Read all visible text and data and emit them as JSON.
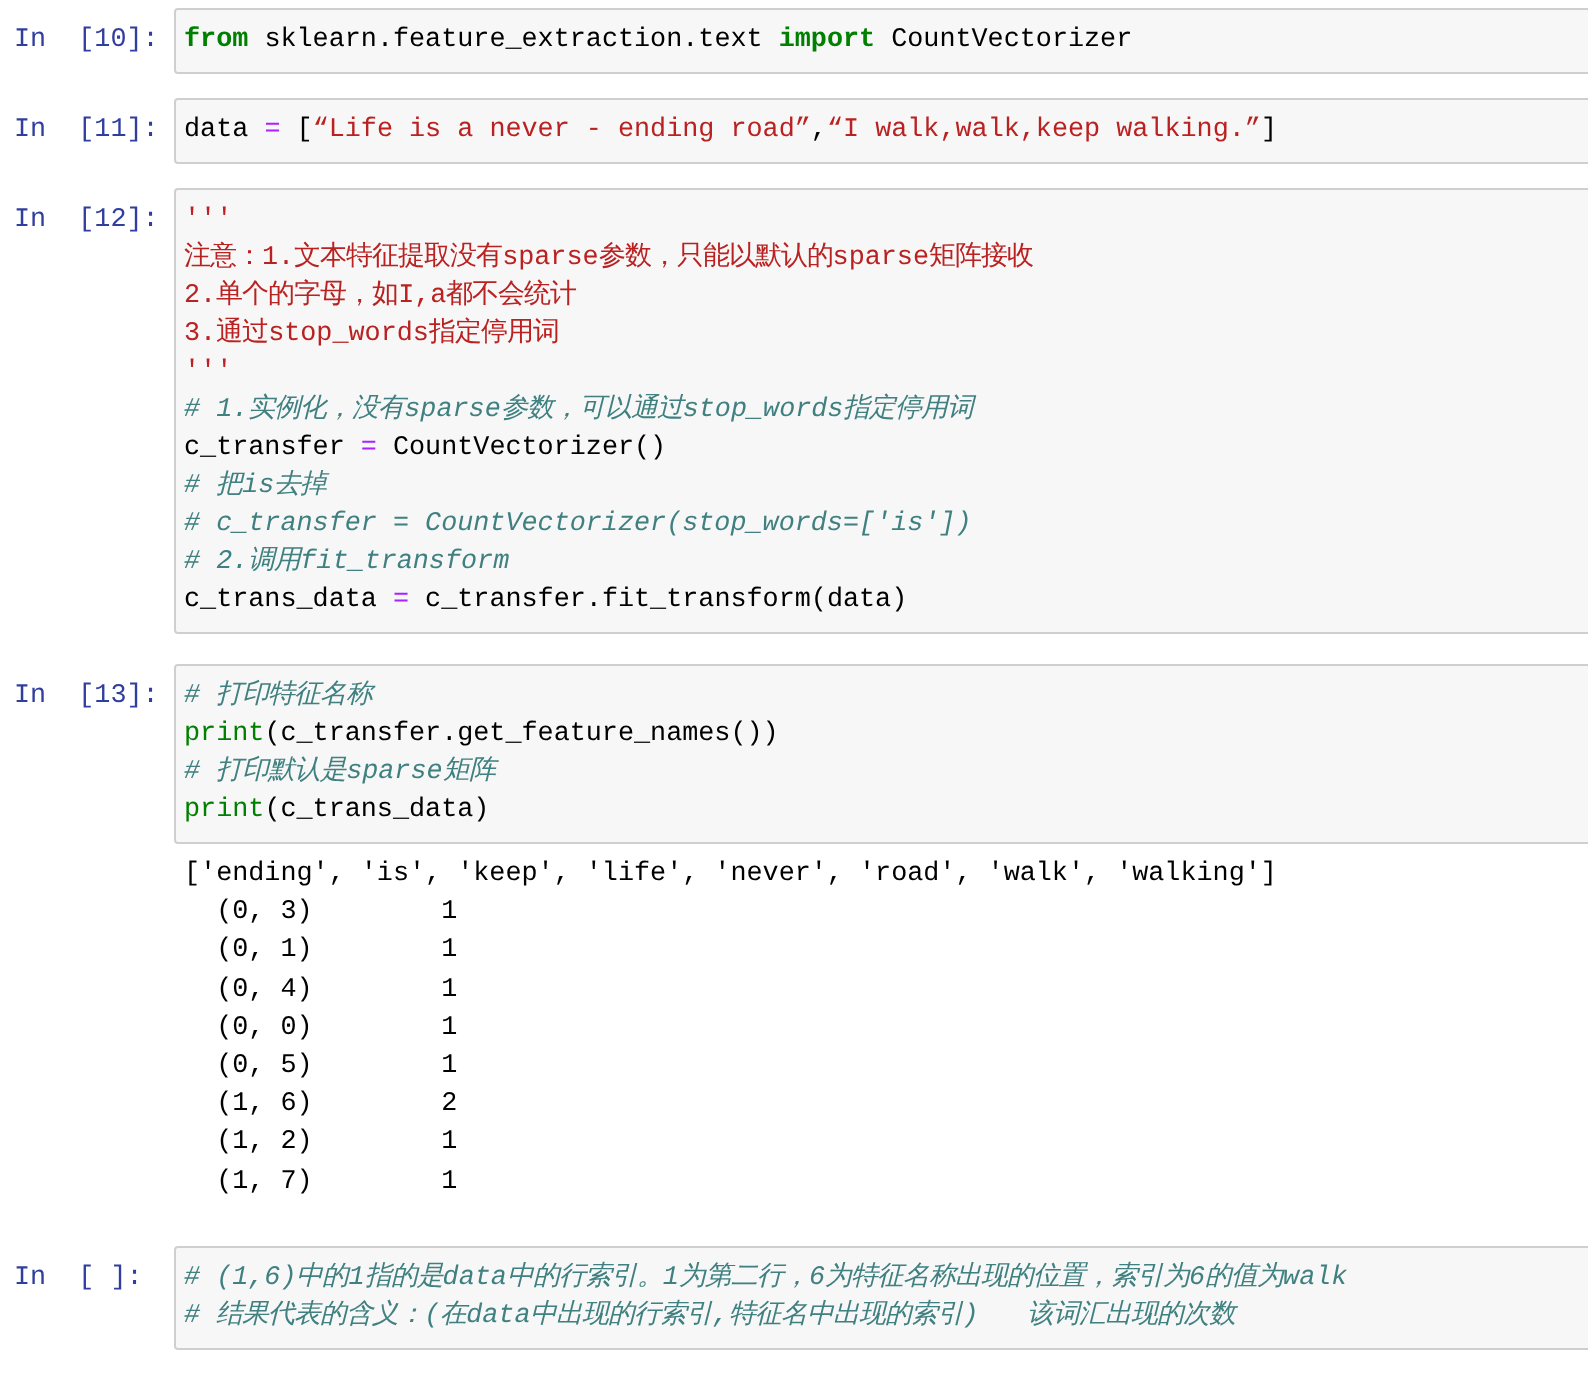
{
  "cells": [
    {
      "prompt": "In  [10]:",
      "lines": [
        [
          {
            "kind": "kw",
            "text": "from"
          },
          {
            "kind": "plain",
            "text": " sklearn.feature_extraction.text "
          },
          {
            "kind": "kw",
            "text": "import"
          },
          {
            "kind": "plain",
            "text": " CountVectorizer"
          }
        ]
      ]
    },
    {
      "prompt": "In  [11]:",
      "lines": [
        [
          {
            "kind": "plain",
            "text": "data "
          },
          {
            "kind": "op",
            "text": "="
          },
          {
            "kind": "plain",
            "text": " ["
          },
          {
            "kind": "str",
            "text": "“Life is a never - ending road”"
          },
          {
            "kind": "plain",
            "text": ","
          },
          {
            "kind": "str",
            "text": "“I walk,walk,keep walking.”"
          },
          {
            "kind": "plain",
            "text": "]"
          }
        ]
      ]
    },
    {
      "prompt": "In  [12]:",
      "lines": [
        [
          {
            "kind": "str",
            "text": "'''"
          }
        ],
        [
          {
            "kind": "str",
            "text": "注意：1.文本特征提取没有sparse参数，只能以默认的sparse矩阵接收"
          }
        ],
        [
          {
            "kind": "str",
            "text": "2.单个的字母，如I,a都不会统计"
          }
        ],
        [
          {
            "kind": "str",
            "text": "3.通过stop_words指定停用词"
          }
        ],
        [
          {
            "kind": "str",
            "text": "'''"
          }
        ],
        [
          {
            "kind": "comment",
            "text": "# 1.实例化，没有sparse参数，可以通过stop_words指定停用词"
          }
        ],
        [
          {
            "kind": "plain",
            "text": "c_transfer "
          },
          {
            "kind": "op",
            "text": "="
          },
          {
            "kind": "plain",
            "text": " CountVectorizer()"
          }
        ],
        [
          {
            "kind": "comment",
            "text": "# 把is去掉"
          }
        ],
        [
          {
            "kind": "comment",
            "text": "# c_transfer = CountVectorizer(stop_words=['is'])"
          }
        ],
        [
          {
            "kind": "comment",
            "text": "# 2.调用fit_transform"
          }
        ],
        [
          {
            "kind": "plain",
            "text": "c_trans_data "
          },
          {
            "kind": "op",
            "text": "="
          },
          {
            "kind": "plain",
            "text": " c_transfer.fit_transform(data)"
          }
        ]
      ]
    },
    {
      "prompt": "In  [13]:",
      "lines": [
        [
          {
            "kind": "comment",
            "text": "# 打印特征名称"
          }
        ],
        [
          {
            "kind": "builtin",
            "text": "print"
          },
          {
            "kind": "plain",
            "text": "(c_transfer.get_feature_names())"
          }
        ],
        [
          {
            "kind": "comment",
            "text": "# 打印默认是sparse矩阵"
          }
        ],
        [
          {
            "kind": "builtin",
            "text": "print"
          },
          {
            "kind": "plain",
            "text": "(c_trans_data)"
          }
        ]
      ],
      "output": [
        "['ending', 'is', 'keep', 'life', 'never', 'road', 'walk', 'walking']",
        "  (0, 3)\t1",
        "  (0, 1)\t1",
        "  (0, 4)\t1",
        "  (0, 0)\t1",
        "  (0, 5)\t1",
        "  (1, 6)\t2",
        "  (1, 2)\t1",
        "  (1, 7)\t1"
      ]
    },
    {
      "prompt": "In  [ ]:",
      "lines": [
        [
          {
            "kind": "comment",
            "text": "# (1,6)中的1指的是data中的行索引。1为第二行，6为特征名称出现的位置，索引为6的值为walk"
          }
        ],
        [
          {
            "kind": "comment",
            "text": "# 结果代表的含义：(在data中出现的行索引,特征名中出现的索引)   该词汇出现的次数"
          }
        ]
      ]
    }
  ]
}
